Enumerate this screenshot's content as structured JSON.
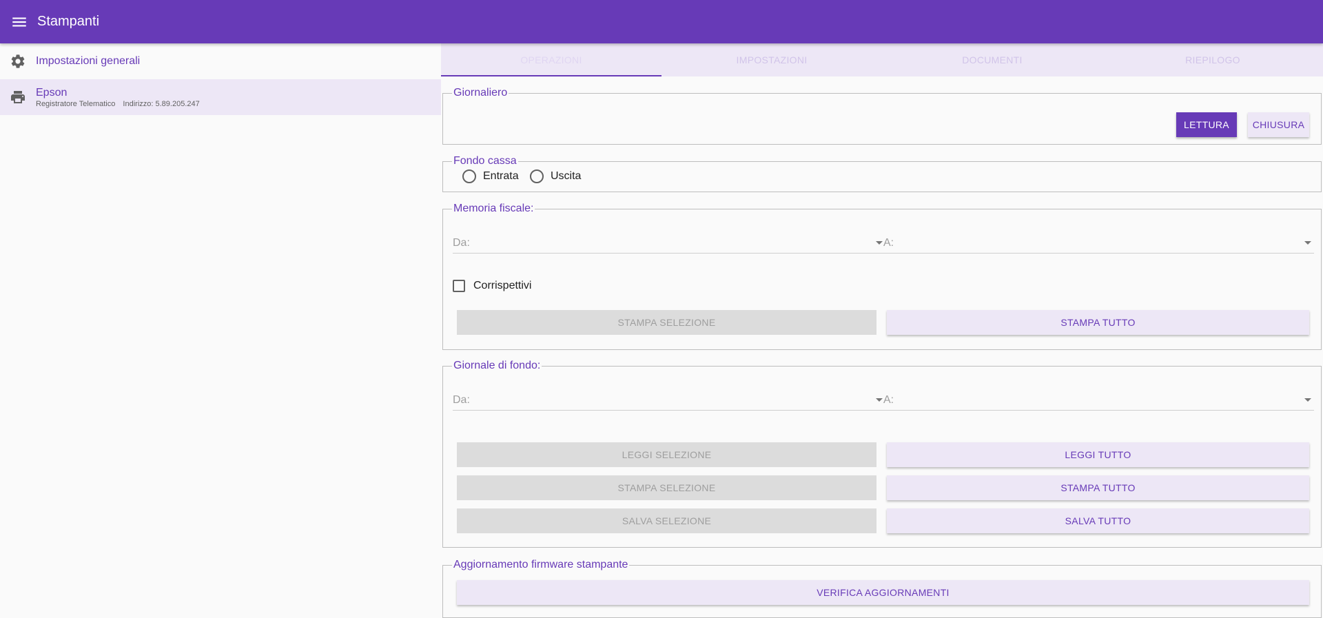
{
  "app": {
    "title": "Stampanti"
  },
  "sidebar": {
    "general_label": "Impostazioni generali",
    "printer": {
      "name": "Epson",
      "type": "Registratore Telematico",
      "address": "Indirizzo: 5.89.205.247"
    }
  },
  "tabs": [
    "OPERAZIONI",
    "IMPOSTAZIONI",
    "DOCUMENTI",
    "RIEPILOGO"
  ],
  "giornaliero": {
    "legend": "Giornaliero",
    "lettura": "LETTURA",
    "chiusura": "CHIUSURA"
  },
  "fondo_cassa": {
    "legend": "Fondo cassa",
    "entrata": "Entrata",
    "uscita": "Uscita"
  },
  "memoria_fiscale": {
    "legend": "Memoria fiscale:",
    "da": "Da:",
    "a": "A:",
    "corrispettivi": "Corrispettivi",
    "stampa_selezione": "STAMPA SELEZIONE",
    "stampa_tutto": "STAMPA TUTTO"
  },
  "giornale_fondo": {
    "legend": "Giornale di fondo:",
    "da": "Da:",
    "a": "A:",
    "leggi_selezione": "LEGGI SELEZIONE",
    "leggi_tutto": "LEGGI TUTTO",
    "stampa_selezione": "STAMPA SELEZIONE",
    "stampa_tutto": "STAMPA TUTTO",
    "salva_selezione": "SALVA SELEZIONE",
    "salva_tutto": "SALVA TUTTO"
  },
  "firmware": {
    "legend": "Aggiornamento firmware stampante",
    "verifica": "VERIFICA AGGIORNAMENTI"
  },
  "colors": {
    "primary": "#673ab7",
    "primary_light": "#ede7f6",
    "disabled": "#dcdcdc"
  }
}
